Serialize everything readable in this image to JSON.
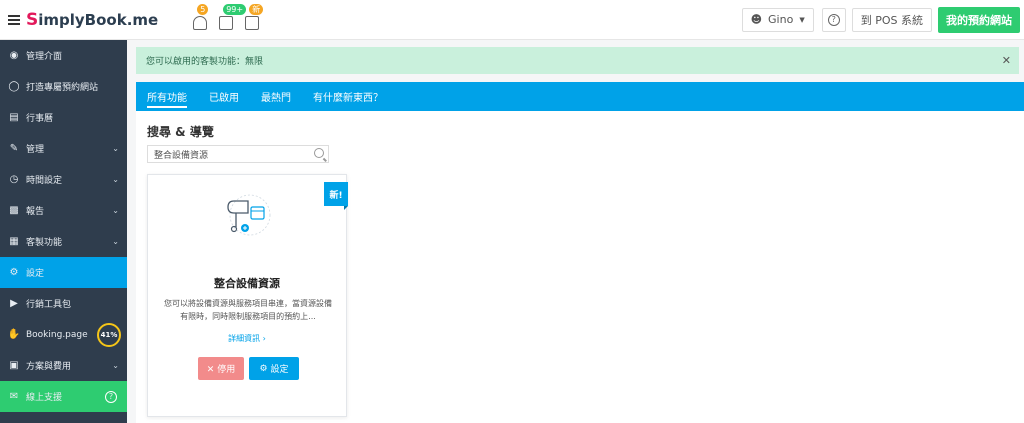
{
  "header": {
    "logo_first": "S",
    "logo_rest": "implyBook",
    "logo_suffix": ".me",
    "badges": [
      "5",
      "99+",
      "新"
    ],
    "user_name": "Gino",
    "pos_label": "到 POS 系統",
    "site_label": "我的預約網站"
  },
  "sidebar": {
    "items": [
      {
        "label": "管理介面",
        "icon": "dashboard-icon"
      },
      {
        "label": "打造專屬預約網站",
        "icon": "bulb-icon"
      },
      {
        "label": "行事曆",
        "icon": "calendar-icon"
      },
      {
        "label": "管理",
        "icon": "pencil-icon"
      },
      {
        "label": "時間設定",
        "icon": "clock-icon"
      },
      {
        "label": "報告",
        "icon": "chart-icon"
      },
      {
        "label": "客製功能",
        "icon": "gift-icon"
      },
      {
        "label": "設定",
        "icon": "gear-icon"
      },
      {
        "label": "行銷工具包",
        "icon": "megaphone-icon"
      },
      {
        "label": "Booking.page",
        "icon": "hand-icon"
      },
      {
        "label": "方案與費用",
        "icon": "money-icon"
      },
      {
        "label": "線上支援",
        "icon": "chat-icon"
      }
    ],
    "booking_progress": "41%"
  },
  "main": {
    "alert_text": "您可以啟用的客製功能：無限",
    "tabs": [
      "所有功能",
      "已啟用",
      "最熱門",
      "有什麼新東西？"
    ],
    "section_title": "搜尋 & 導覽",
    "search_value": "整合設備資源",
    "card": {
      "ribbon": "新!",
      "title": "整合設備資源",
      "description": "您可以將設備資源與服務項目串連，當資源設備有限時，同時限制服務項目的預約上...",
      "link": "詳細資訊 ›",
      "disable_label": "✕ 停用",
      "settings_label": "設定"
    }
  },
  "colors": {
    "accent": "#00a2e8",
    "sidebar": "#2f3d4d",
    "success": "#2ecc71",
    "danger": "#f28b8b"
  }
}
